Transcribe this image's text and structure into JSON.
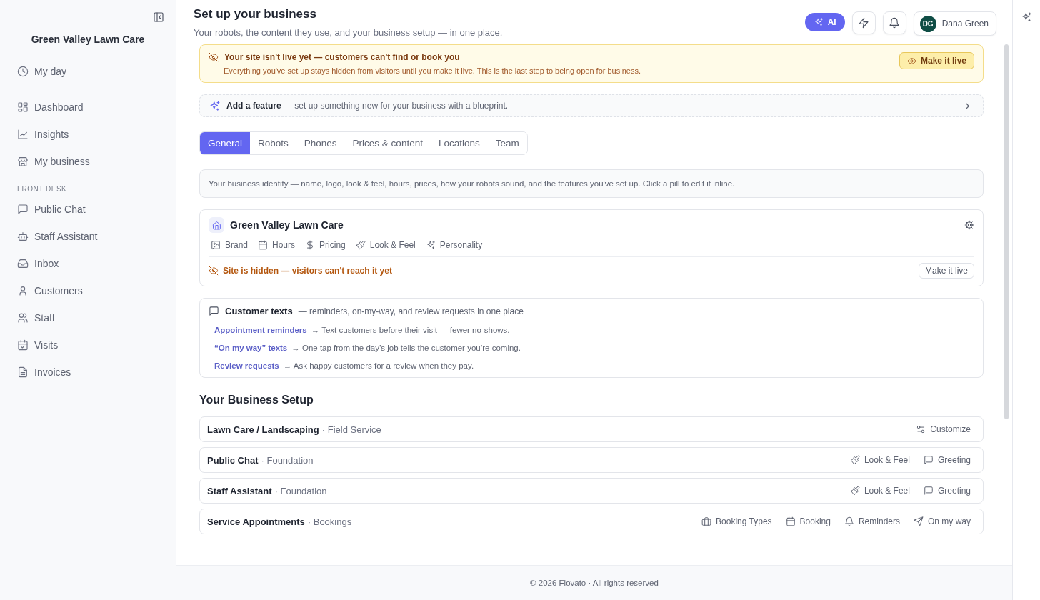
{
  "sidebar": {
    "title": "Green Valley Lawn Care",
    "top_items": [
      {
        "label": "My day"
      }
    ],
    "main_items": [
      {
        "label": "Dashboard"
      },
      {
        "label": "Insights"
      },
      {
        "label": "My business"
      }
    ],
    "section_title": "FRONT DESK",
    "section_items": [
      {
        "label": "Public Chat"
      },
      {
        "label": "Staff Assistant"
      },
      {
        "label": "Inbox"
      },
      {
        "label": "Customers"
      },
      {
        "label": "Staff"
      },
      {
        "label": "Visits"
      },
      {
        "label": "Invoices"
      }
    ]
  },
  "header": {
    "title": "Set up your business",
    "subtitle": "Your robots, the content they use, and your business setup — in one place.",
    "ai_button": "AI",
    "user": {
      "initials": "DG",
      "name": "Dana Green"
    }
  },
  "alert": {
    "title": "Your site isn't live yet — customers can't find or book you",
    "body": "Everything you've set up stays hidden from visitors until you make it live. This is the last step to being open for business.",
    "button": "Make it live"
  },
  "feature_banner": {
    "text": "**Add a feature** — set up something new for your business with a blueprint."
  },
  "tabs": [
    {
      "label": "General",
      "selected": true
    },
    {
      "label": "Robots",
      "selected": false
    },
    {
      "label": "Phones",
      "selected": false
    },
    {
      "label": "Prices & content",
      "selected": false
    },
    {
      "label": "Locations",
      "selected": false
    },
    {
      "label": "Team",
      "selected": false
    }
  ],
  "description": "Your business identity — name, logo, look & feel, hours, prices, how your robots sound, and the features you've set up. Click a pill to edit it inline.",
  "business_card": {
    "name": "Green Valley Lawn Care",
    "pills": [
      "Brand",
      "Hours",
      "Pricing",
      "Look & Feel",
      "Personality"
    ],
    "status": "Site is hidden — visitors can't reach it yet",
    "button": "Make it live"
  },
  "customer_texts": {
    "title": "Customer texts",
    "subtitle": "— reminders, on-my-way, and review requests in one place",
    "items": [
      {
        "link": "Appointment reminders",
        "text": "→  Text customers before their visit — fewer no-shows."
      },
      {
        "link": "“On my way” texts",
        "text": "→  One tap from the day’s job tells the customer you’re coming."
      },
      {
        "link": "Review requests",
        "text": "→  Ask happy customers for a review when they pay."
      }
    ]
  },
  "setup": {
    "title": "Your Business Setup",
    "rows": [
      {
        "name": "Lawn Care / Landscaping",
        "category": "· Field Service",
        "actions": [
          "Customize"
        ]
      },
      {
        "name": "Public Chat",
        "category": "· Foundation",
        "actions": [
          "Look & Feel",
          "Greeting"
        ]
      },
      {
        "name": "Staff Assistant",
        "category": "· Foundation",
        "actions": [
          "Look & Feel",
          "Greeting"
        ]
      },
      {
        "name": "Service Appointments",
        "category": "· Bookings",
        "actions": [
          "Booking Types",
          "Booking",
          "Reminders",
          "On my way"
        ]
      }
    ]
  },
  "footer": "© 2026 Flovato · All rights reserved"
}
